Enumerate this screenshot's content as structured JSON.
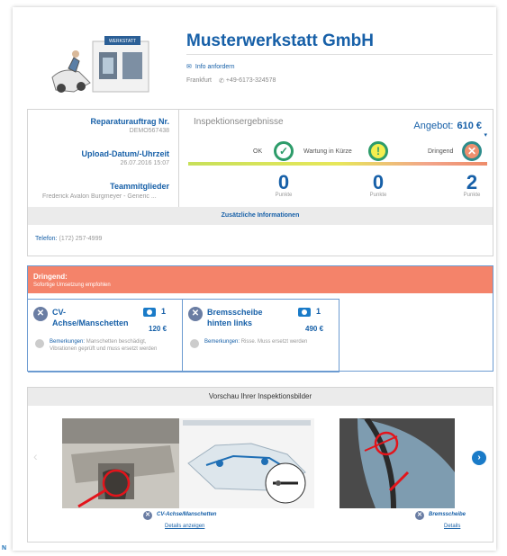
{
  "header": {
    "company_name": "Musterwerkstatt GmbH",
    "info_link": "Info anfordern",
    "location": "Frankfurt",
    "phone": "+49-6173-324578",
    "logo_sign_text": "WERKSTATT"
  },
  "details": {
    "order_label": "Reparaturauftrag Nr.",
    "order_value": "DEMO567438",
    "upload_label": "Upload-Datum/-Uhrzeit",
    "upload_value": "26.07.2016 15:07",
    "team_label": "Teammitglieder",
    "team_value": "Frederick Avalon Burgmeyer - Generic ..."
  },
  "inspection": {
    "title": "Inspektionsergebnisse",
    "offer_label": "Angebot:",
    "offer_value": "610 €",
    "categories": [
      {
        "label": "OK",
        "points": "0",
        "points_label": "Punkte",
        "icon": "check-icon"
      },
      {
        "label": "Wartung in Kürze",
        "points": "0",
        "points_label": "Punkte",
        "icon": "exclamation-icon"
      },
      {
        "label": "Dringend",
        "points": "2",
        "points_label": "Punkte",
        "icon": "close-icon"
      }
    ],
    "additional_info": "Zusätzliche Informationen",
    "phone_label": "Telefon:",
    "phone_value": "(172) 257-4999"
  },
  "urgent": {
    "title": "Dringend:",
    "subtitle": "Sofortige Umsetzung empfohlen",
    "items": [
      {
        "name": "CV-Achse/Manschetten",
        "photo_count": "1",
        "price": "120 €",
        "remark_label": "Bemerkungen:",
        "remark": "Manschetten beschädigt, Vibrationen geprüft und muss ersetzt werden"
      },
      {
        "name": "Bremsscheibe hinten links",
        "photo_count": "1",
        "price": "490 €",
        "remark_label": "Bemerkungen:",
        "remark": "Risse. Muss ersetzt werden"
      }
    ]
  },
  "preview": {
    "title": "Vorschau Ihrer Inspektionsbilder",
    "captions": [
      {
        "name": "CV-Achse/Manschetten",
        "link": "Details anzeigen"
      },
      {
        "name": "Bremsscheibe",
        "link": "Details"
      }
    ]
  },
  "colors": {
    "brand": "#1760a8",
    "urgent_bar": "#f4836a",
    "ok": "#2d9c6a",
    "warn": "#f4ee4f"
  },
  "footer_mark": "N"
}
